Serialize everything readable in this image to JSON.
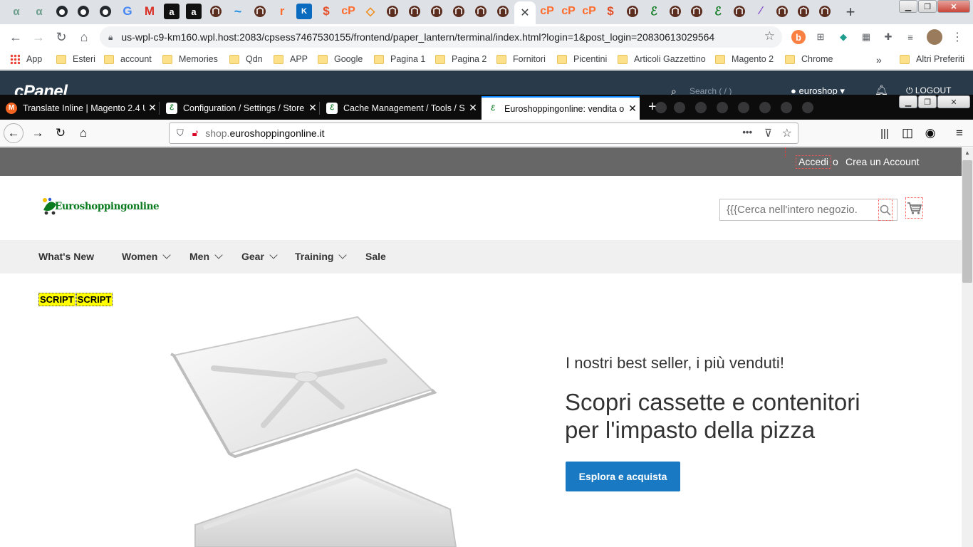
{
  "chrome": {
    "address": "us-wpl-c9-km160.wpl.host:2083/cpsess7467530155/frontend/paper_lantern/terminal/index.html?login=1&post_login=20830613029564",
    "bookmarks": [
      "App",
      "Esteri",
      "account",
      "Memories",
      "Qdn",
      "APP",
      "Google",
      "Pagina 1",
      "Pagina 2",
      "Fornitori",
      "Picentini",
      "Articoli Gazzettino",
      "Magento 2",
      "Chrome"
    ],
    "more_bookmarks": "»",
    "other_bookmarks": "Altri Preferiti",
    "new_tab": "+",
    "close_tab": "✕"
  },
  "cpanel": {
    "logo": "cPanel",
    "search_placeholder": "Search ( / )",
    "user": "euroshop",
    "logout": "LOGOUT"
  },
  "firefox": {
    "tabs": [
      {
        "label": "Translate Inline | Magento 2.4 U",
        "icon": "magento-icon"
      },
      {
        "label": "Configuration / Settings / Store",
        "icon": "euroshopping-icon"
      },
      {
        "label": "Cache Management / Tools / S",
        "icon": "euroshopping-icon"
      },
      {
        "label": "Euroshoppingonline: vendita o",
        "icon": "euroshopping-icon",
        "active": true
      }
    ],
    "url_prefix": "shop.",
    "url_domain": "euroshoppingonline.it",
    "more": "•••"
  },
  "site": {
    "login": "Accedi",
    "or": "o",
    "create_account": "Crea un Account",
    "logo_text": "Euroshoppingonline",
    "search_placeholder": "{{{Cerca nell'intero negozio.",
    "nav": [
      {
        "label": "What's New",
        "dropdown": false
      },
      {
        "label": "Women",
        "dropdown": true
      },
      {
        "label": "Men",
        "dropdown": true
      },
      {
        "label": "Gear",
        "dropdown": true
      },
      {
        "label": "Training",
        "dropdown": true
      },
      {
        "label": "Sale",
        "dropdown": false
      }
    ],
    "script_badges": [
      "SCRIPT",
      "SCRIPT"
    ],
    "hero": {
      "kicker": "I nostri best seller, i più venduti!",
      "title_line1": "Scopri cassette e contenitori",
      "title_line2": "per l'impasto della pizza",
      "cta": "Esplora e acquista"
    },
    "colors": {
      "topbar": "#676767",
      "cta": "#1979c3",
      "nav_bg": "#f0f0f0",
      "logo_green": "#0a7a1f"
    }
  }
}
